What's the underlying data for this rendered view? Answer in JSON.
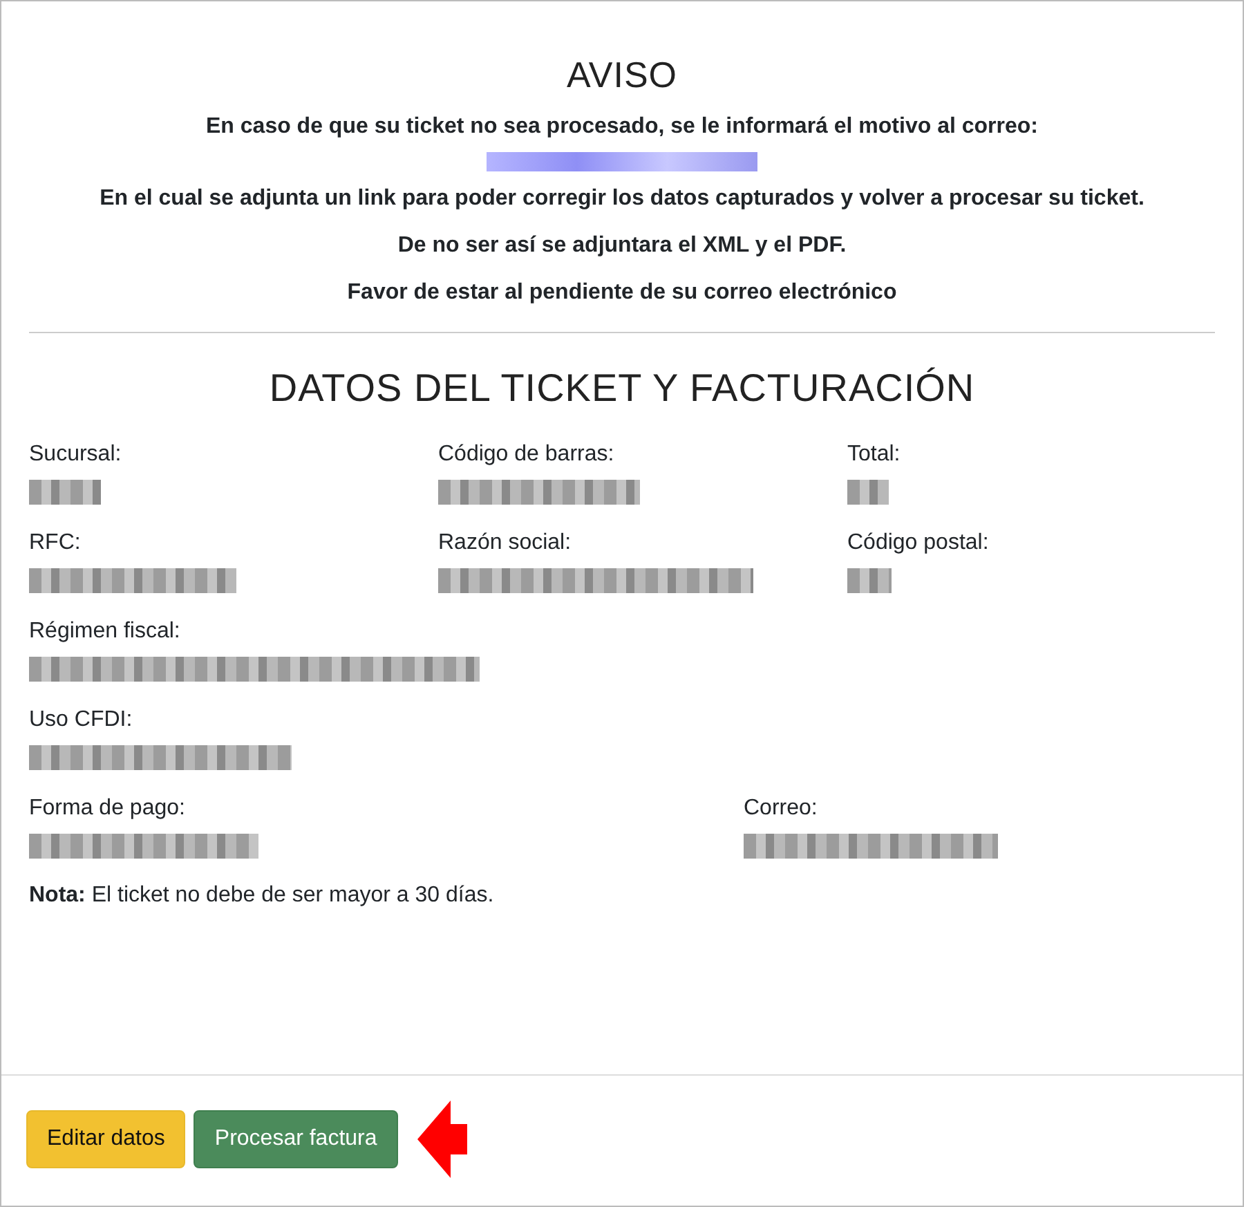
{
  "notice": {
    "title": "AVISO",
    "lines": [
      "En caso de que su ticket no sea procesado, se le informará el motivo al correo:",
      "En el cual se adjunta un link para poder corregir los datos capturados y volver a procesar su ticket.",
      "De no ser así se adjuntara el XML y el PDF.",
      "Favor de estar al pendiente de su correo electrónico"
    ]
  },
  "ticket": {
    "title": "DATOS DEL TICKET Y FACTURACIÓN",
    "rows": [
      {
        "fields": [
          {
            "label": "Sucursal:"
          },
          {
            "label": "Código de barras:"
          },
          {
            "label": "Total:"
          }
        ]
      },
      {
        "fields": [
          {
            "label": "RFC:"
          },
          {
            "label": "Razón social:"
          },
          {
            "label": "Código postal:"
          }
        ]
      },
      {
        "fields": [
          {
            "label": "Régimen fiscal:"
          }
        ]
      },
      {
        "fields": [
          {
            "label": "Uso CFDI:"
          }
        ]
      },
      {
        "fields": [
          {
            "label": "Forma de pago:"
          },
          {
            "label": "Correo:"
          }
        ]
      }
    ],
    "note": "**Nota:** El ticket no debe de ser mayor a 30 días."
  },
  "buttons": [
    {
      "label": "Editar datos",
      "kind": "warning"
    },
    {
      "label": "Procesar factura",
      "kind": "success"
    }
  ]
}
